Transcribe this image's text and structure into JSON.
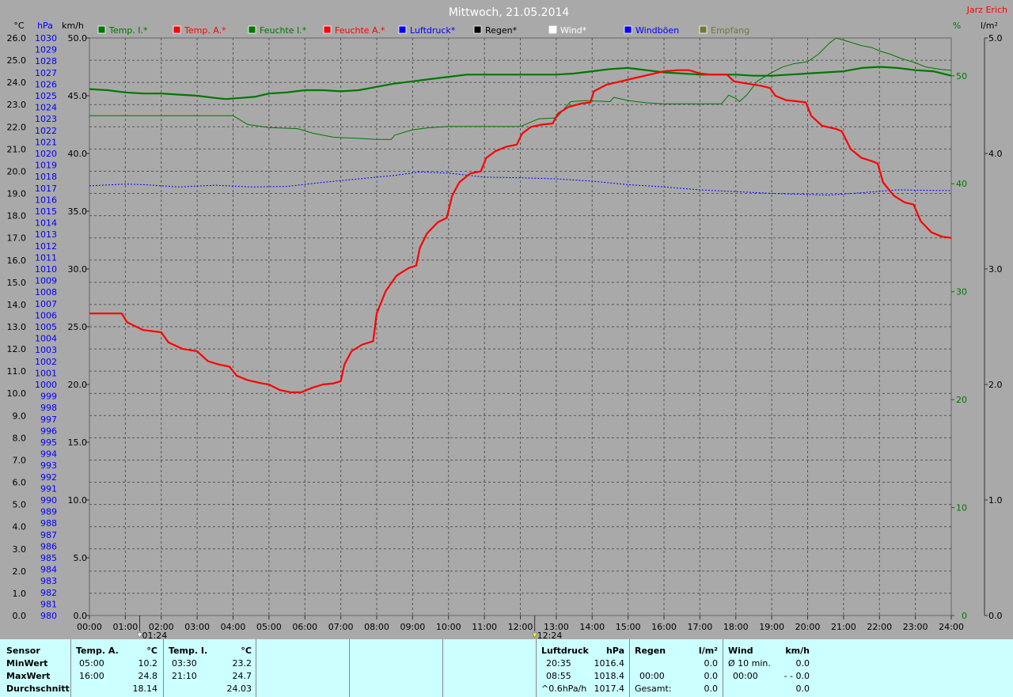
{
  "title": "Mittwoch, 21.05.2014",
  "owner": "Jarz Erich",
  "unit_labels": {
    "temp": "°C",
    "pressure": "hPa",
    "speed": "km/h",
    "humidity": "%",
    "rain": "l/m²"
  },
  "legend": [
    {
      "label": "Temp. I.*",
      "color": "#007700"
    },
    {
      "label": "Temp. A.*",
      "color": "#ff0000"
    },
    {
      "label": "Feuchte I.*",
      "color": "#007700"
    },
    {
      "label": "Feuchte A.*",
      "color": "#ff0000"
    },
    {
      "label": "Luftdruck*",
      "color": "#0000ff"
    },
    {
      "label": "Regen*",
      "color": "#000000"
    },
    {
      "label": "Wind*",
      "color": "#ffffff"
    },
    {
      "label": "Windböen",
      "color": "#0000ff"
    },
    {
      "label": "Empfang",
      "color": "#777733"
    }
  ],
  "markers": [
    {
      "label": "01:24",
      "time": 1.4,
      "color": "#ffffff"
    },
    {
      "label": "12:24",
      "time": 12.4,
      "color": "#ffff00"
    }
  ],
  "chart_data": {
    "type": "line",
    "x_range": [
      0,
      24
    ],
    "x_ticks": [
      "00:00",
      "01:00",
      "02:00",
      "03:00",
      "04:00",
      "05:00",
      "06:00",
      "07:00",
      "08:00",
      "09:00",
      "10:00",
      "11:00",
      "12:00",
      "13:00",
      "14:00",
      "15:00",
      "16:00",
      "17:00",
      "18:00",
      "19:00",
      "20:00",
      "21:00",
      "22:00",
      "23:00",
      "24:00"
    ],
    "temp_axis": {
      "range": [
        0,
        26
      ],
      "ticks": [
        "0.0",
        "1.0",
        "2.0",
        "3.0",
        "4.0",
        "5.0",
        "6.0",
        "7.0",
        "8.0",
        "9.0",
        "10.0",
        "11.0",
        "12.0",
        "13.0",
        "14.0",
        "15.0",
        "16.0",
        "17.0",
        "18.0",
        "19.0",
        "20.0",
        "21.0",
        "22.0",
        "23.0",
        "24.0",
        "25.0",
        "26.0"
      ]
    },
    "pressure_axis": {
      "range": [
        980,
        1030
      ],
      "ticks": [
        "980",
        "981",
        "982",
        "983",
        "984",
        "985",
        "986",
        "987",
        "988",
        "989",
        "990",
        "991",
        "992",
        "993",
        "994",
        "995",
        "996",
        "997",
        "998",
        "999",
        "1000",
        "1001",
        "1002",
        "1003",
        "1004",
        "1005",
        "1006",
        "1007",
        "1008",
        "1009",
        "1010",
        "1011",
        "1012",
        "1013",
        "1014",
        "1015",
        "1016",
        "1017",
        "1018",
        "1019",
        "1020",
        "1021",
        "1022",
        "1023",
        "1024",
        "1025",
        "1026",
        "1027",
        "1028",
        "1029",
        "1030"
      ]
    },
    "speed_axis": {
      "range": [
        0,
        50
      ],
      "ticks": [
        "0.0",
        "5.0",
        "10.0",
        "15.0",
        "20.0",
        "25.0",
        "30.0",
        "35.0",
        "40.0",
        "45.0",
        "50.0"
      ]
    },
    "humidity_axis": {
      "range": [
        0,
        53.5
      ],
      "ticks": [
        "0",
        "10",
        "20",
        "30",
        "40",
        "50"
      ]
    },
    "rain_axis": {
      "range": [
        0,
        5
      ],
      "ticks": [
        "0.0",
        "1.0",
        "2.0",
        "3.0",
        "4.0",
        "5.0"
      ]
    },
    "series": [
      {
        "name": "Temp. A.*",
        "axis": "temp",
        "color": "#ff0000",
        "width": 2.2,
        "points": [
          [
            0,
            13.6
          ],
          [
            0.9,
            13.6
          ],
          [
            1.05,
            13.2
          ],
          [
            1.5,
            12.85
          ],
          [
            2.0,
            12.75
          ],
          [
            2.2,
            12.3
          ],
          [
            2.6,
            12.0
          ],
          [
            3.0,
            11.9
          ],
          [
            3.3,
            11.45
          ],
          [
            3.6,
            11.3
          ],
          [
            3.9,
            11.2
          ],
          [
            4.1,
            10.8
          ],
          [
            4.4,
            10.6
          ],
          [
            4.8,
            10.45
          ],
          [
            5.0,
            10.4
          ],
          [
            5.3,
            10.15
          ],
          [
            5.6,
            10.05
          ],
          [
            5.9,
            10.05
          ],
          [
            6.2,
            10.25
          ],
          [
            6.5,
            10.4
          ],
          [
            6.8,
            10.45
          ],
          [
            7.0,
            10.55
          ],
          [
            7.1,
            11.3
          ],
          [
            7.3,
            11.9
          ],
          [
            7.6,
            12.2
          ],
          [
            7.9,
            12.35
          ],
          [
            8.0,
            13.6
          ],
          [
            8.25,
            14.6
          ],
          [
            8.55,
            15.3
          ],
          [
            8.9,
            15.65
          ],
          [
            9.1,
            15.75
          ],
          [
            9.2,
            16.55
          ],
          [
            9.4,
            17.2
          ],
          [
            9.7,
            17.7
          ],
          [
            9.95,
            17.9
          ],
          [
            10.1,
            18.9
          ],
          [
            10.3,
            19.5
          ],
          [
            10.6,
            19.9
          ],
          [
            10.9,
            20.0
          ],
          [
            11.05,
            20.6
          ],
          [
            11.3,
            20.9
          ],
          [
            11.6,
            21.1
          ],
          [
            11.9,
            21.2
          ],
          [
            12.05,
            21.7
          ],
          [
            12.3,
            22.0
          ],
          [
            12.6,
            22.1
          ],
          [
            12.9,
            22.15
          ],
          [
            13.05,
            22.6
          ],
          [
            13.35,
            22.9
          ],
          [
            13.7,
            23.05
          ],
          [
            13.95,
            23.1
          ],
          [
            14.05,
            23.6
          ],
          [
            14.4,
            23.9
          ],
          [
            14.8,
            24.05
          ],
          [
            15.2,
            24.2
          ],
          [
            15.6,
            24.35
          ],
          [
            16.0,
            24.5
          ],
          [
            16.4,
            24.55
          ],
          [
            16.7,
            24.55
          ],
          [
            17.0,
            24.4
          ],
          [
            17.3,
            24.35
          ],
          [
            17.75,
            24.35
          ],
          [
            17.95,
            24.05
          ],
          [
            18.3,
            23.95
          ],
          [
            18.7,
            23.85
          ],
          [
            18.95,
            23.75
          ],
          [
            19.1,
            23.4
          ],
          [
            19.4,
            23.2
          ],
          [
            19.7,
            23.15
          ],
          [
            19.95,
            23.1
          ],
          [
            20.1,
            22.5
          ],
          [
            20.4,
            22.05
          ],
          [
            20.8,
            21.9
          ],
          [
            20.95,
            21.8
          ],
          [
            21.2,
            21.0
          ],
          [
            21.5,
            20.6
          ],
          [
            21.8,
            20.45
          ],
          [
            21.95,
            20.35
          ],
          [
            22.1,
            19.5
          ],
          [
            22.4,
            18.9
          ],
          [
            22.7,
            18.6
          ],
          [
            22.95,
            18.5
          ],
          [
            23.15,
            17.75
          ],
          [
            23.45,
            17.25
          ],
          [
            23.75,
            17.05
          ],
          [
            24,
            17.0
          ]
        ]
      },
      {
        "name": "Temp. I.*",
        "axis": "temp",
        "color": "#007700",
        "width": 2.2,
        "points": [
          [
            0,
            23.7
          ],
          [
            0.5,
            23.65
          ],
          [
            1.0,
            23.55
          ],
          [
            1.5,
            23.5
          ],
          [
            2.0,
            23.5
          ],
          [
            2.5,
            23.45
          ],
          [
            3.0,
            23.4
          ],
          [
            3.5,
            23.3
          ],
          [
            3.8,
            23.25
          ],
          [
            4.2,
            23.3
          ],
          [
            4.6,
            23.35
          ],
          [
            5.0,
            23.5
          ],
          [
            5.5,
            23.55
          ],
          [
            6.0,
            23.65
          ],
          [
            6.5,
            23.65
          ],
          [
            7.0,
            23.6
          ],
          [
            7.5,
            23.65
          ],
          [
            8.0,
            23.8
          ],
          [
            8.5,
            23.95
          ],
          [
            9.0,
            24.05
          ],
          [
            9.5,
            24.15
          ],
          [
            10.0,
            24.25
          ],
          [
            10.5,
            24.35
          ],
          [
            11.0,
            24.35
          ],
          [
            11.5,
            24.35
          ],
          [
            12.0,
            24.35
          ],
          [
            12.5,
            24.35
          ],
          [
            13.0,
            24.35
          ],
          [
            13.5,
            24.4
          ],
          [
            14.0,
            24.5
          ],
          [
            14.5,
            24.6
          ],
          [
            15.0,
            24.65
          ],
          [
            15.5,
            24.55
          ],
          [
            16.0,
            24.45
          ],
          [
            16.5,
            24.4
          ],
          [
            17.0,
            24.35
          ],
          [
            17.5,
            24.35
          ],
          [
            18.0,
            24.35
          ],
          [
            18.5,
            24.3
          ],
          [
            19.0,
            24.3
          ],
          [
            19.5,
            24.35
          ],
          [
            20.0,
            24.4
          ],
          [
            20.5,
            24.45
          ],
          [
            21.0,
            24.5
          ],
          [
            21.5,
            24.65
          ],
          [
            22.0,
            24.7
          ],
          [
            22.5,
            24.65
          ],
          [
            23.0,
            24.55
          ],
          [
            23.5,
            24.5
          ],
          [
            24,
            24.3
          ]
        ]
      },
      {
        "name": "Feuchte I.*",
        "axis": "humidity",
        "color": "#007700",
        "width": 1,
        "points": [
          [
            0,
            46.3
          ],
          [
            4.0,
            46.3
          ],
          [
            4.4,
            45.5
          ],
          [
            5.0,
            45.2
          ],
          [
            5.8,
            45.1
          ],
          [
            6.2,
            44.7
          ],
          [
            6.8,
            44.3
          ],
          [
            7.5,
            44.2
          ],
          [
            8.0,
            44.1
          ],
          [
            8.4,
            44.1
          ],
          [
            8.5,
            44.5
          ],
          [
            9.0,
            45.0
          ],
          [
            9.5,
            45.2
          ],
          [
            10.0,
            45.3
          ],
          [
            11.0,
            45.3
          ],
          [
            11.8,
            45.3
          ],
          [
            12.0,
            45.3
          ],
          [
            12.5,
            46.0
          ],
          [
            13.0,
            46.1
          ],
          [
            13.4,
            47.6
          ],
          [
            13.8,
            47.7
          ],
          [
            14.5,
            47.6
          ],
          [
            14.6,
            48.0
          ],
          [
            15.0,
            47.7
          ],
          [
            15.5,
            47.5
          ],
          [
            16.0,
            47.4
          ],
          [
            17.0,
            47.4
          ],
          [
            17.6,
            47.4
          ],
          [
            17.8,
            48.2
          ],
          [
            18.0,
            47.9
          ],
          [
            18.1,
            47.6
          ],
          [
            18.3,
            48.2
          ],
          [
            18.6,
            49.5
          ],
          [
            19.0,
            50.3
          ],
          [
            19.3,
            50.8
          ],
          [
            19.6,
            51.1
          ],
          [
            20.0,
            51.3
          ],
          [
            20.3,
            52.0
          ],
          [
            20.6,
            53.0
          ],
          [
            20.8,
            53.5
          ],
          [
            21.1,
            53.2
          ],
          [
            21.5,
            52.8
          ],
          [
            21.8,
            52.6
          ],
          [
            22.0,
            52.3
          ],
          [
            22.3,
            52.0
          ],
          [
            22.6,
            51.6
          ],
          [
            23.0,
            51.2
          ],
          [
            23.3,
            50.8
          ],
          [
            23.7,
            50.6
          ],
          [
            24,
            50.5
          ]
        ]
      },
      {
        "name": "Luftdruck*",
        "axis": "pressure",
        "color": "#0000ff",
        "width": 1,
        "dash": "2,2",
        "points": [
          [
            0,
            1017.2
          ],
          [
            1.0,
            1017.35
          ],
          [
            1.5,
            1017.3
          ],
          [
            2.5,
            1017.1
          ],
          [
            3.5,
            1017.25
          ],
          [
            4.5,
            1017.1
          ],
          [
            5.5,
            1017.15
          ],
          [
            6.5,
            1017.5
          ],
          [
            7.5,
            1017.8
          ],
          [
            8.5,
            1018.1
          ],
          [
            9.2,
            1018.4
          ],
          [
            10.0,
            1018.3
          ],
          [
            11.0,
            1017.95
          ],
          [
            12.0,
            1017.9
          ],
          [
            13.0,
            1017.8
          ],
          [
            14.0,
            1017.6
          ],
          [
            15.0,
            1017.3
          ],
          [
            16.0,
            1017.1
          ],
          [
            17.0,
            1016.85
          ],
          [
            18.0,
            1016.7
          ],
          [
            19.0,
            1016.55
          ],
          [
            20.0,
            1016.45
          ],
          [
            20.6,
            1016.4
          ],
          [
            21.5,
            1016.6
          ],
          [
            22.5,
            1016.85
          ],
          [
            23.5,
            1016.8
          ],
          [
            24,
            1016.8
          ]
        ]
      }
    ]
  },
  "stats": {
    "labels": {
      "sensor": "Sensor",
      "min": "MinWert",
      "max": "MaxWert",
      "avg": "Durchschnitt"
    },
    "temp_a": {
      "title": "Temp. A.",
      "unit": "°C",
      "min_time": "05:00",
      "min_val": "10.2",
      "max_time": "16:00",
      "max_val": "24.8",
      "avg": "18.14"
    },
    "temp_i": {
      "title": "Temp. I.",
      "unit": "°C",
      "min_time": "03:30",
      "min_val": "23.2",
      "max_time": "21:10",
      "max_val": "24.7",
      "avg": "24.03"
    },
    "pressure": {
      "title": "Luftdruck",
      "unit": "hPa",
      "min_time": "20:35",
      "min_val": "1016.4",
      "max_time": "08:55",
      "max_val": "1018.4",
      "trend": "^0.6hPa/h",
      "avg": "1017.4"
    },
    "rain": {
      "title": "Regen",
      "unit": "l/m²",
      "max_time": "00:00",
      "max_val": "0.0",
      "total_label": "Gesamt:",
      "total": "0.0",
      "min_val": "0.0"
    },
    "wind": {
      "title": "Wind",
      "unit": "km/h",
      "min_label": "Ø 10 min.",
      "min_val": "0.0",
      "max_time": "00:00",
      "max_val": "- - 0.0",
      "avg": "0.0"
    }
  }
}
